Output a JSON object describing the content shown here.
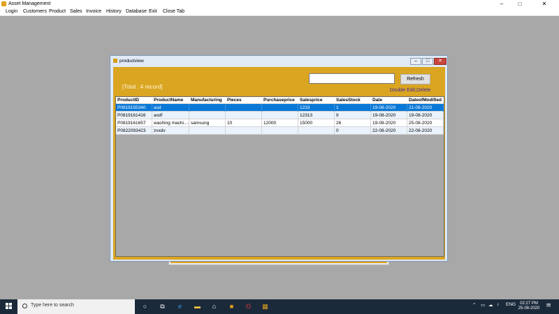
{
  "app": {
    "title": "Asset Management",
    "minimize": "–",
    "maximize": "□",
    "close": "✕"
  },
  "menu": [
    "Login",
    "Customers",
    "Product",
    "Sales",
    "Invoice",
    "History",
    "Database",
    "Exit",
    "Close Tab"
  ],
  "child": {
    "title": "productview",
    "search_value": "",
    "refresh_label": "Refresh",
    "total_label": "[Total : 4 record]",
    "hint": "Double Edit,Delete",
    "columns": [
      "ProductID",
      "ProductName",
      "Manufacturing",
      "Pieces",
      "Purchaseprice",
      "Salesprice",
      "SalesStock",
      "Date",
      "DateofModified"
    ],
    "rows": [
      [
        "P0819155340",
        "asd",
        "",
        "",
        "",
        "1233",
        "1",
        "19-08-2020",
        "21-08-2020"
      ],
      [
        "P0819161416",
        "asdf",
        "",
        "",
        "",
        "12313",
        "9",
        "19-08-2020",
        "19-08-2020"
      ],
      [
        "P0819161657",
        "washing machi....",
        "samsung",
        "10",
        "12000",
        "15000",
        "26",
        "19-08-2020",
        "25-08-2020"
      ],
      [
        "P0822093423",
        "zvxdv",
        "",
        "",
        "",
        "",
        "0",
        "22-08-2020",
        "22-08-2020"
      ]
    ],
    "selected_row": 0
  },
  "taskbar": {
    "search_placeholder": "Type here to search",
    "lang": "ENG",
    "time": "02:27 PM",
    "date": "25-08-2020"
  },
  "colors": {
    "form_bg": "#daa520",
    "selection": "#0a78d7",
    "desktop": "#a8a8a8",
    "taskbar": "#1b2a3b"
  }
}
